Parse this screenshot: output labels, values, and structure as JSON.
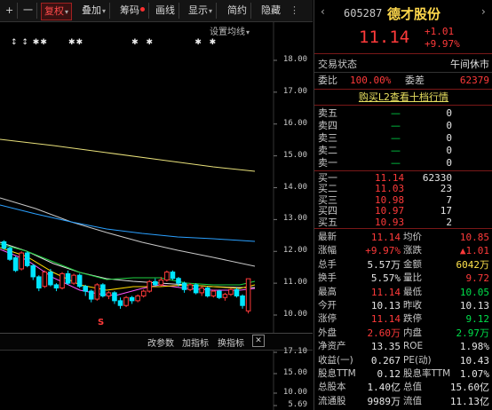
{
  "toolbar": {
    "plus": "+",
    "minus": "一",
    "fuquan": "复权",
    "diejia": "叠加",
    "choumа": "",
    "chouma": "筹码",
    "huaxian": "画线",
    "xianshi": "显示",
    "jianyue": "简约",
    "yincang": "隐藏"
  },
  "chart": {
    "settings_label": "设置均线",
    "markers": "↕ ↕ ✱✱      ✱✱              ✱  ✱            ✱  ✱",
    "price_axis": [
      "18.00",
      "17.00",
      "16.00",
      "15.00",
      "14.00",
      "13.00",
      "12.00",
      "11.00",
      "10.00"
    ],
    "indicator_bar": {
      "change_params": "改参数",
      "add_indicator": "加指标",
      "switch_indicator": "换指标",
      "close": "✕"
    },
    "indicator_axis": [
      "17.10",
      "15.00",
      "10.00",
      "5.69"
    ],
    "s_marker": "S"
  },
  "chart_data": {
    "type": "candlestick",
    "title": "",
    "xlabel": "",
    "ylabel": "",
    "ylim": [
      9.6,
      18.6
    ],
    "ma_colors": [
      "#e8e07a",
      "#c8c8c8",
      "#2aa0ff",
      "#e0e0e0",
      "#ff55ff",
      "#ffd800",
      "#20d040"
    ],
    "candles": [
      {
        "o": 12.3,
        "c": 12.1,
        "h": 12.35,
        "l": 12.05
      },
      {
        "o": 12.1,
        "c": 11.75,
        "h": 12.15,
        "l": 11.7
      },
      {
        "o": 11.8,
        "c": 11.4,
        "h": 11.85,
        "l": 11.35
      },
      {
        "o": 11.45,
        "c": 11.95,
        "h": 12.0,
        "l": 11.4
      },
      {
        "o": 11.95,
        "c": 11.55,
        "h": 12.0,
        "l": 11.5
      },
      {
        "o": 11.55,
        "c": 11.2,
        "h": 11.6,
        "l": 11.1
      },
      {
        "o": 11.2,
        "c": 10.85,
        "h": 11.25,
        "l": 10.75
      },
      {
        "o": 10.9,
        "c": 11.35,
        "h": 11.4,
        "l": 10.85
      },
      {
        "o": 11.35,
        "c": 10.95,
        "h": 11.45,
        "l": 10.9
      },
      {
        "o": 10.95,
        "c": 10.85,
        "h": 11.0,
        "l": 10.75
      },
      {
        "o": 10.85,
        "c": 11.3,
        "h": 11.35,
        "l": 10.8
      },
      {
        "o": 11.3,
        "c": 11.0,
        "h": 11.4,
        "l": 10.95
      },
      {
        "o": 11.0,
        "c": 11.25,
        "h": 11.3,
        "l": 10.95
      },
      {
        "o": 11.25,
        "c": 10.9,
        "h": 11.3,
        "l": 10.85
      },
      {
        "o": 10.9,
        "c": 10.75,
        "h": 10.95,
        "l": 10.6
      },
      {
        "o": 10.75,
        "c": 10.5,
        "h": 10.8,
        "l": 10.4
      },
      {
        "o": 10.5,
        "c": 10.95,
        "h": 11.0,
        "l": 10.45
      },
      {
        "o": 10.95,
        "c": 10.6,
        "h": 11.0,
        "l": 10.55
      },
      {
        "o": 10.6,
        "c": 10.7,
        "h": 10.75,
        "l": 10.5
      },
      {
        "o": 10.7,
        "c": 10.45,
        "h": 10.75,
        "l": 10.35
      },
      {
        "o": 10.45,
        "c": 10.3,
        "h": 10.55,
        "l": 10.2
      },
      {
        "o": 10.3,
        "c": 10.55,
        "h": 10.6,
        "l": 10.25
      },
      {
        "o": 10.55,
        "c": 10.45,
        "h": 10.6,
        "l": 10.35
      },
      {
        "o": 10.45,
        "c": 10.6,
        "h": 10.65,
        "l": 10.4
      },
      {
        "o": 10.6,
        "c": 10.75,
        "h": 10.8,
        "l": 10.55
      },
      {
        "o": 10.75,
        "c": 11.05,
        "h": 11.1,
        "l": 10.7
      },
      {
        "o": 11.05,
        "c": 10.95,
        "h": 11.15,
        "l": 10.9
      },
      {
        "o": 10.95,
        "c": 11.1,
        "h": 11.2,
        "l": 10.9
      },
      {
        "o": 11.1,
        "c": 11.35,
        "h": 11.4,
        "l": 11.05
      },
      {
        "o": 11.35,
        "c": 11.15,
        "h": 11.4,
        "l": 11.1
      },
      {
        "o": 11.15,
        "c": 11.0,
        "h": 11.2,
        "l": 10.9
      },
      {
        "o": 11.0,
        "c": 10.8,
        "h": 11.05,
        "l": 10.7
      },
      {
        "o": 10.8,
        "c": 10.95,
        "h": 11.0,
        "l": 10.75
      },
      {
        "o": 10.95,
        "c": 10.7,
        "h": 11.0,
        "l": 10.65
      },
      {
        "o": 10.7,
        "c": 10.85,
        "h": 10.9,
        "l": 10.6
      },
      {
        "o": 10.85,
        "c": 10.6,
        "h": 10.9,
        "l": 10.55
      },
      {
        "o": 10.6,
        "c": 10.75,
        "h": 10.8,
        "l": 10.55
      },
      {
        "o": 10.75,
        "c": 10.55,
        "h": 10.8,
        "l": 10.5
      },
      {
        "o": 10.55,
        "c": 10.65,
        "h": 10.7,
        "l": 10.45
      },
      {
        "o": 10.65,
        "c": 10.8,
        "h": 10.85,
        "l": 10.6
      },
      {
        "o": 10.8,
        "c": 10.6,
        "h": 10.85,
        "l": 10.55
      },
      {
        "o": 10.6,
        "c": 10.3,
        "h": 10.65,
        "l": 10.2
      },
      {
        "o": 10.13,
        "c": 11.14,
        "h": 11.14,
        "l": 10.05
      }
    ]
  },
  "quote": {
    "code": "605287",
    "name": "德才股份",
    "price": "11.14",
    "change": "+1.01",
    "change_pct": "+9.97%",
    "status_label": "交易状态",
    "status_value": "午间休市",
    "weibi_label": "委比",
    "weibi_value": "100.00%",
    "weicha_label": "委差",
    "weicha_value": "62379",
    "l2_link": "购买L2查看十档行情"
  },
  "order_book": {
    "asks": [
      {
        "label": "卖五",
        "price": "—",
        "vol": "0"
      },
      {
        "label": "卖四",
        "price": "—",
        "vol": "0"
      },
      {
        "label": "卖三",
        "price": "—",
        "vol": "0"
      },
      {
        "label": "卖二",
        "price": "—",
        "vol": "0"
      },
      {
        "label": "卖一",
        "price": "—",
        "vol": "0"
      }
    ],
    "bids": [
      {
        "label": "买一",
        "price": "11.14",
        "vol": "62330"
      },
      {
        "label": "买二",
        "price": "11.03",
        "vol": "23"
      },
      {
        "label": "买三",
        "price": "10.98",
        "vol": "7"
      },
      {
        "label": "买四",
        "price": "10.97",
        "vol": "17"
      },
      {
        "label": "买五",
        "price": "10.93",
        "vol": "2"
      }
    ]
  },
  "stats": [
    {
      "l1": "最新",
      "v1": "11.14",
      "c1": "red",
      "l2": "均价",
      "v2": "10.85",
      "c2": "red"
    },
    {
      "l1": "涨幅",
      "v1": "+9.97%",
      "c1": "red",
      "l2": "涨跌",
      "v2": "▲1.01",
      "c2": "red"
    },
    {
      "l1": "总手",
      "v1": "5.57万",
      "c1": "wht",
      "l2": "金额",
      "v2": "6042万",
      "c2": "yel"
    },
    {
      "l1": "换手",
      "v1": "5.57%",
      "c1": "wht",
      "l2": "量比",
      "v2": "9.72",
      "c2": "red"
    },
    {
      "l1": "最高",
      "v1": "11.14",
      "c1": "red",
      "l2": "最低",
      "v2": "10.05",
      "c2": "green"
    },
    {
      "l1": "今开",
      "v1": "10.13",
      "c1": "wht",
      "l2": "昨收",
      "v2": "10.13",
      "c2": "wht"
    },
    {
      "l1": "涨停",
      "v1": "11.14",
      "c1": "red",
      "l2": "跌停",
      "v2": "9.12",
      "c2": "green"
    },
    {
      "l1": "外盘",
      "v1": "2.60万",
      "c1": "red",
      "l2": "内盘",
      "v2": "2.97万",
      "c2": "green"
    },
    {
      "l1": "净资产",
      "v1": "13.35",
      "c1": "wht",
      "l2": "ROE",
      "v2": "1.98%",
      "c2": "wht"
    },
    {
      "l1": "收益(一)",
      "v1": "0.267",
      "c1": "wht",
      "l2": "PE(动)",
      "v2": "10.43",
      "c2": "wht"
    },
    {
      "l1": "股息TTM",
      "v1": "0.12",
      "c1": "wht",
      "l2": "股息率TTM",
      "v2": "1.07%",
      "c2": "wht"
    },
    {
      "l1": "总股本",
      "v1": "1.40亿",
      "c1": "wht",
      "l2": "总值",
      "v2": "15.60亿",
      "c2": "wht"
    },
    {
      "l1": "流通股",
      "v1": "9989万",
      "c1": "wht",
      "l2": "流值",
      "v2": "11.13亿",
      "c2": "wht"
    }
  ]
}
